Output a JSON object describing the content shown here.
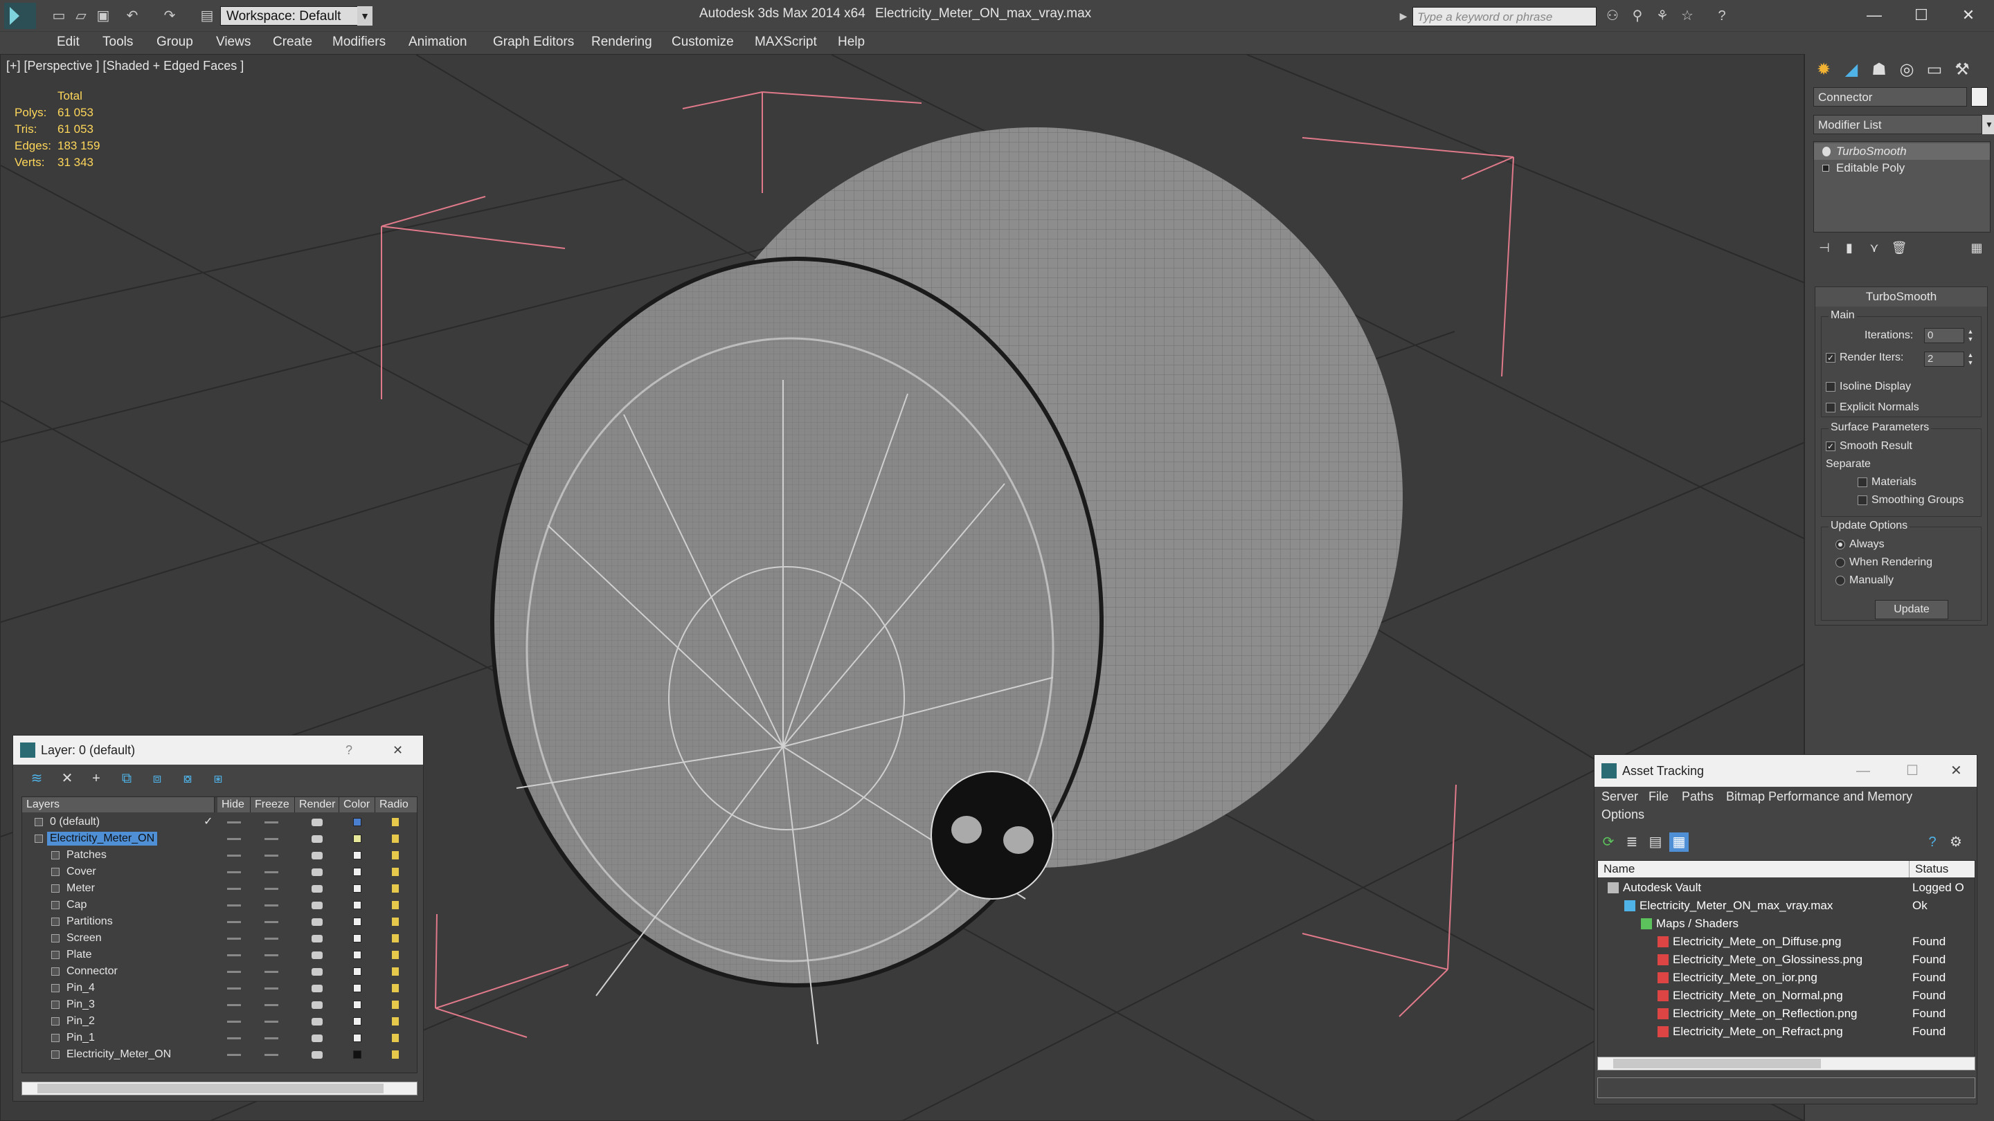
{
  "titlebar": {
    "workspace": "Workspace: Default",
    "app_title": "Autodesk 3ds Max  2014 x64",
    "file_title": "Electricity_Meter_ON_max_vray.max",
    "search_placeholder": "Type a keyword or phrase"
  },
  "menu": [
    "Edit",
    "Tools",
    "Group",
    "Views",
    "Create",
    "Modifiers",
    "Animation",
    "Graph Editors",
    "Rendering",
    "Customize",
    "MAXScript",
    "Help"
  ],
  "viewport": {
    "label": "[+] [Perspective ] [Shaded + Edged Faces ]",
    "stats": {
      "header": "Total",
      "rows": [
        {
          "key": "Polys:",
          "value": "61 053"
        },
        {
          "key": "Tris:",
          "value": "61 053"
        },
        {
          "key": "Edges:",
          "value": "183 159"
        },
        {
          "key": "Verts:",
          "value": "31 343"
        }
      ]
    }
  },
  "command_panel": {
    "object_name": "Connector",
    "modifier_list": "Modifier List",
    "stack": [
      "TurboSmooth",
      "Editable Poly"
    ],
    "turbosmooth": {
      "header": "TurboSmooth",
      "main_group": "Main",
      "iterations_label": "Iterations:",
      "iterations_value": "0",
      "render_iters_label": "Render Iters:",
      "render_iters_value": "2",
      "isoline_display": "Isoline Display",
      "explicit_normals": "Explicit Normals",
      "surface_group": "Surface Parameters",
      "smooth_result": "Smooth Result",
      "separate": "Separate",
      "materials": "Materials",
      "smoothing_groups": "Smoothing Groups",
      "update_group": "Update Options",
      "always": "Always",
      "when_rendering": "When Rendering",
      "manually": "Manually",
      "update_button": "Update"
    }
  },
  "layer_window": {
    "title": "Layer: 0 (default)",
    "help": "?",
    "close": "✕",
    "columns": [
      "Layers",
      "Hide",
      "Freeze",
      "Render",
      "Color",
      "Radio"
    ],
    "rows": [
      {
        "name": "0 (default)",
        "level": 0,
        "color": "#4a7fd0",
        "selected": false,
        "check": "✓"
      },
      {
        "name": "Electricity_Meter_ON",
        "level": 0,
        "color": "#e8e89a",
        "selected": true,
        "check": ""
      },
      {
        "name": "Patches",
        "level": 1,
        "color": "#f0f0f0",
        "selected": false,
        "check": ""
      },
      {
        "name": "Cover",
        "level": 1,
        "color": "#f0f0f0",
        "selected": false,
        "check": ""
      },
      {
        "name": "Meter",
        "level": 1,
        "color": "#f0f0f0",
        "selected": false,
        "check": ""
      },
      {
        "name": "Cap",
        "level": 1,
        "color": "#f0f0f0",
        "selected": false,
        "check": ""
      },
      {
        "name": "Partitions",
        "level": 1,
        "color": "#f0f0f0",
        "selected": false,
        "check": ""
      },
      {
        "name": "Screen",
        "level": 1,
        "color": "#f0f0f0",
        "selected": false,
        "check": ""
      },
      {
        "name": "Plate",
        "level": 1,
        "color": "#f0f0f0",
        "selected": false,
        "check": ""
      },
      {
        "name": "Connector",
        "level": 1,
        "color": "#f0f0f0",
        "selected": false,
        "check": ""
      },
      {
        "name": "Pin_4",
        "level": 1,
        "color": "#f0f0f0",
        "selected": false,
        "check": ""
      },
      {
        "name": "Pin_3",
        "level": 1,
        "color": "#f0f0f0",
        "selected": false,
        "check": ""
      },
      {
        "name": "Pin_2",
        "level": 1,
        "color": "#f0f0f0",
        "selected": false,
        "check": ""
      },
      {
        "name": "Pin_1",
        "level": 1,
        "color": "#f0f0f0",
        "selected": false,
        "check": ""
      },
      {
        "name": "Electricity_Meter_ON",
        "level": 1,
        "color": "#111111",
        "selected": false,
        "check": ""
      }
    ]
  },
  "asset_window": {
    "title": "Asset Tracking",
    "menu": [
      "Server",
      "File",
      "Paths",
      "Bitmap Performance and Memory",
      "Options"
    ],
    "columns": [
      "Name",
      "Status"
    ],
    "rows": [
      {
        "name": "Autodesk Vault",
        "status": "Logged O",
        "level": 0,
        "icon": "vault-icon"
      },
      {
        "name": "Electricity_Meter_ON_max_vray.max",
        "status": "Ok",
        "level": 1,
        "icon": "max-file-icon"
      },
      {
        "name": "Maps / Shaders",
        "status": "",
        "level": 2,
        "icon": "maps-icon"
      },
      {
        "name": "Electricity_Mete_on_Diffuse.png",
        "status": "Found",
        "level": 3,
        "icon": "png-icon"
      },
      {
        "name": "Electricity_Mete_on_Glossiness.png",
        "status": "Found",
        "level": 3,
        "icon": "png-icon"
      },
      {
        "name": "Electricity_Mete_on_ior.png",
        "status": "Found",
        "level": 3,
        "icon": "png-icon"
      },
      {
        "name": "Electricity_Mete_on_Normal.png",
        "status": "Found",
        "level": 3,
        "icon": "png-icon"
      },
      {
        "name": "Electricity_Mete_on_Reflection.png",
        "status": "Found",
        "level": 3,
        "icon": "png-icon"
      },
      {
        "name": "Electricity_Mete_on_Refract.png",
        "status": "Found",
        "level": 3,
        "icon": "png-icon"
      }
    ]
  }
}
